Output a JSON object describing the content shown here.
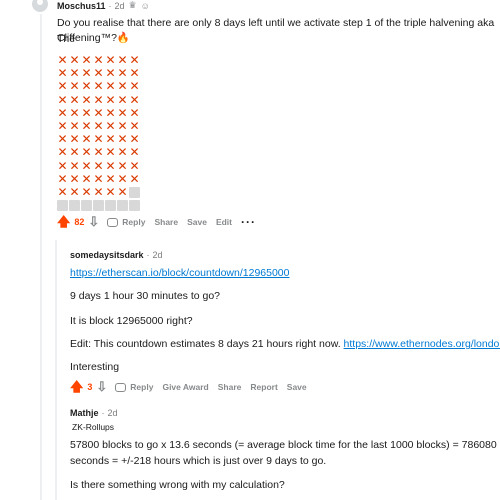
{
  "comment1": {
    "username": "Moschus11",
    "age": "2d",
    "body_line1": "Do you realise that there are only 8 days left until we activate step 1 of the triple halvening aka The",
    "body_line2": "Cliffening™?🔥",
    "grid": {
      "filled": 76,
      "total": 84,
      "columns": 7
    },
    "score": "82",
    "actions": {
      "reply": "Reply",
      "share": "Share",
      "save": "Save",
      "edit": "Edit",
      "more": "···"
    }
  },
  "comment2": {
    "username": "somedaysitsdark",
    "age": "2d",
    "link": "https://etherscan.io/block/countdown/12965000",
    "p1": "9 days 1 hour 30 minutes to go?",
    "p2": "It is block 12965000 right?",
    "p3_text": "Edit: This countdown estimates 8 days 21 hours right now. ",
    "p3_link": "https://www.ethernodes.org/london",
    "p4": "Interesting",
    "score": "3",
    "actions": {
      "reply": "Reply",
      "give_award": "Give Award",
      "share": "Share",
      "report": "Report",
      "save": "Save"
    }
  },
  "comment3": {
    "username": "Mathje",
    "age": "2d",
    "flair": "ZK-Rollups",
    "p1_line1": "57800 blocks to go x 13.6 seconds (= average block time for the last 1000 blocks) = 786080",
    "p1_line2": "seconds = +/-218 hours which is just over 9 days to go.",
    "p2": "Is there something wrong with my calculation?"
  }
}
